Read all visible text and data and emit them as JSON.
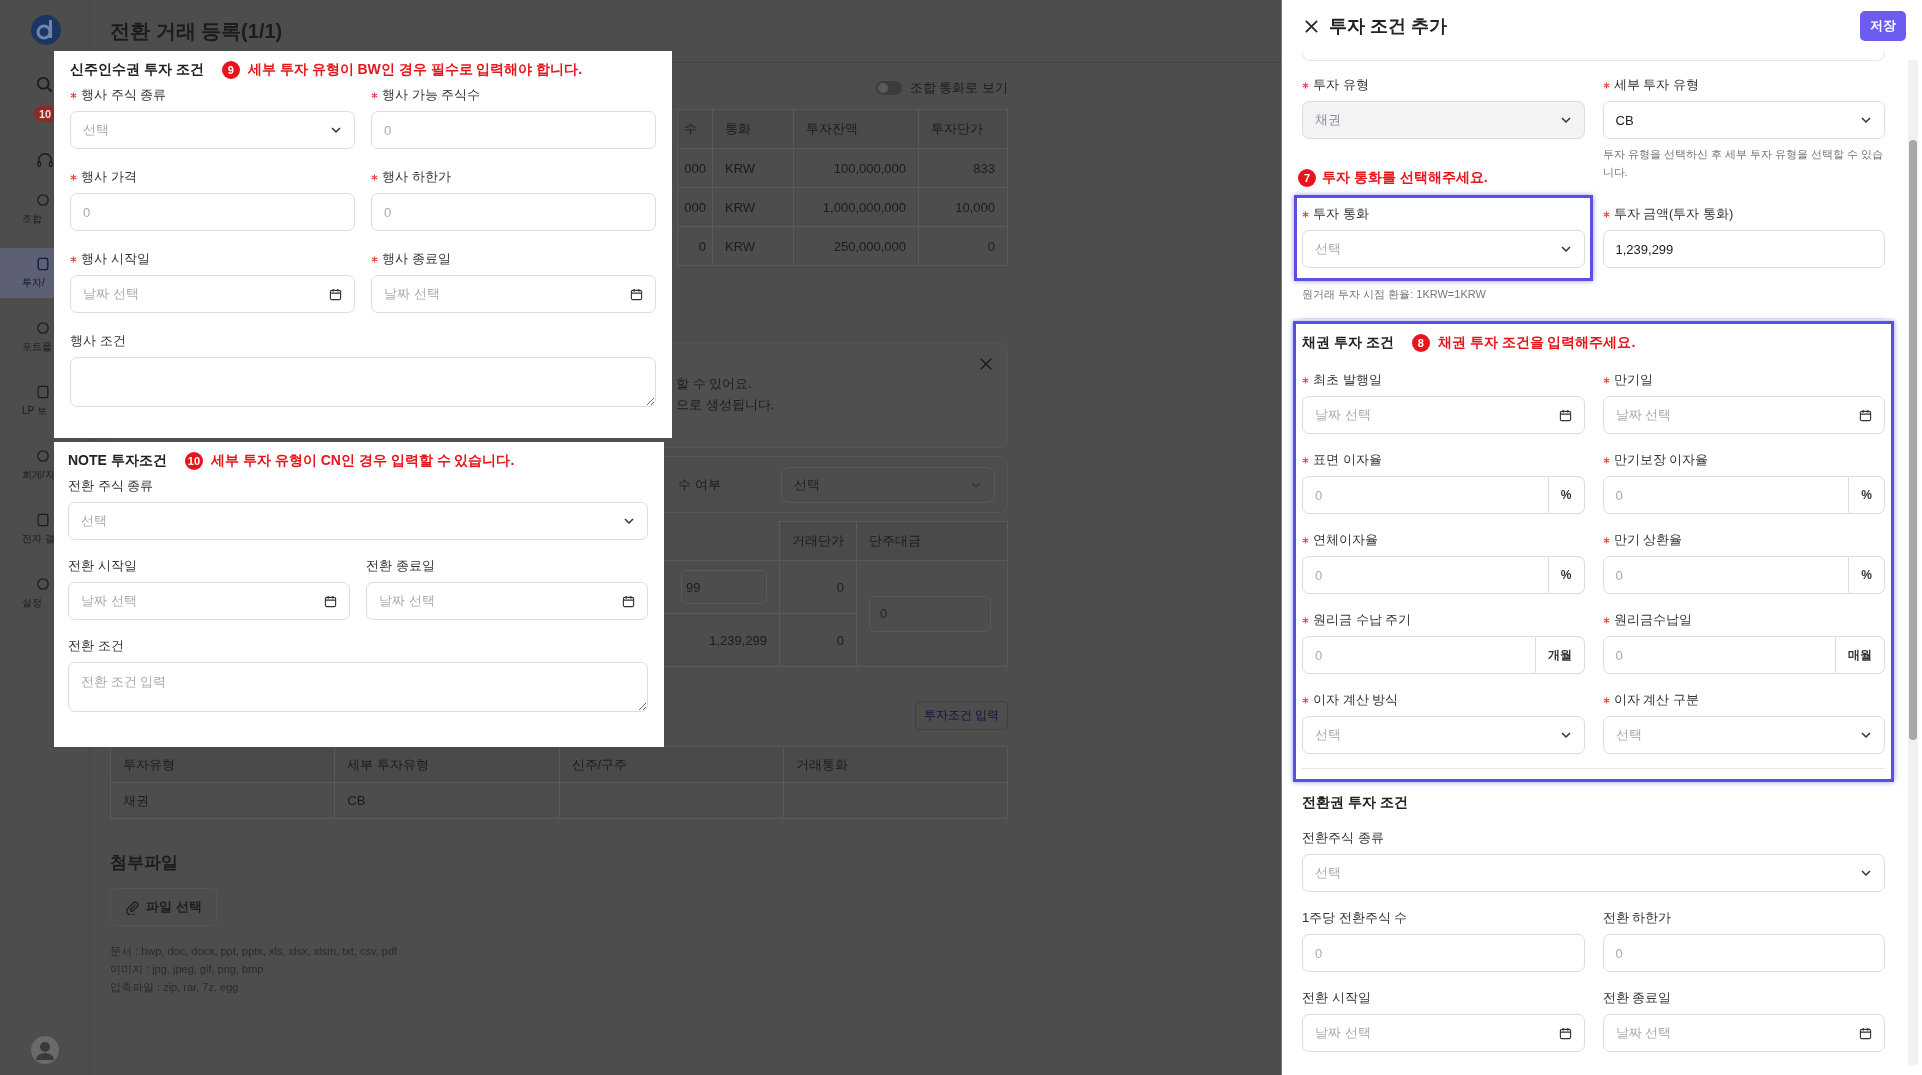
{
  "sidebar": {
    "badge": "10",
    "items": [
      {
        "label": "조합",
        "selected": false
      },
      {
        "label": "투자/",
        "selected": true
      },
      {
        "label": "포트폴",
        "selected": false
      },
      {
        "label": "LP 보",
        "selected": false
      },
      {
        "label": "회계/자",
        "selected": false
      },
      {
        "label": "전자 결",
        "selected": false
      },
      {
        "label": "설정",
        "selected": false
      }
    ]
  },
  "page": {
    "title": "전환 거래 등록(1/1)",
    "toggle": {
      "label": "조합 통화로 보기",
      "on": false
    },
    "summary_table": {
      "columns": [
        "수",
        "통화",
        "투자잔액",
        "투자단가"
      ],
      "rows": [
        [
          "000",
          "KRW",
          "100,000,000",
          "833"
        ],
        [
          "000",
          "KRW",
          "1,000,000,000",
          "10,000"
        ],
        [
          "0",
          "KRW",
          "250,000,000",
          "0"
        ]
      ]
    },
    "notice": {
      "lines": [
        "할 수 있어요.",
        "으로 생성됩니다."
      ]
    },
    "option_row": {
      "label": "수 여부",
      "select": {
        "placeholder": "선택"
      }
    },
    "trade_table": {
      "columns": [
        "거래단가",
        "단주대금"
      ],
      "rows": [
        {
          "amount": {
            "kind": "input",
            "text": "99"
          },
          "price": "0"
        },
        {
          "amount": {
            "kind": "text",
            "text": "1,239,299"
          },
          "price": "0"
        }
      ],
      "odd_lot": {
        "placeholder": "0"
      }
    },
    "terms_button": "투자조건 입력",
    "terms_table": {
      "columns": [
        "투자유형",
        "세부 투자유형",
        "신주/구주",
        "거래통화"
      ],
      "rows": [
        [
          "채권",
          "CB"
        ]
      ]
    },
    "attachments": {
      "title": "첨부파일",
      "button": "파일 선택",
      "notes": [
        "문서 : hwp, doc, docx, ppt, pptx, xls, xlsx, xlsm, txt, csv, pdf",
        "이미지 : jpg, jpeg, gif, png, bmp",
        "압축파일 : zip, rar, 7z, egg"
      ]
    }
  },
  "warrant_panel": {
    "title": "신주인수권 투자 조건",
    "annotation": {
      "number": "9",
      "text": "세부 투자 유형이 BW인 경우 필수로 입력해야 합니다."
    },
    "fields": [
      {
        "label": "행사 주식 종류",
        "required": true,
        "kind": "select",
        "placeholder": "선택"
      },
      {
        "label": "행사 가능 주식수",
        "required": true,
        "kind": "input",
        "placeholder": "0"
      },
      {
        "label": "행사 가격",
        "required": true,
        "kind": "input",
        "placeholder": "0"
      },
      {
        "label": "행사 하한가",
        "required": true,
        "kind": "input",
        "placeholder": "0"
      },
      {
        "label": "행사 시작일",
        "required": true,
        "kind": "date",
        "placeholder": "날짜 선택"
      },
      {
        "label": "행사 종료일",
        "required": true,
        "kind": "date",
        "placeholder": "날짜 선택"
      },
      {
        "label": "행사 조건",
        "required": false,
        "kind": "textarea",
        "wide": true
      }
    ]
  },
  "note_panel": {
    "title": "NOTE 투자조건",
    "annotation": {
      "number": "10",
      "text": "세부 투자 유형이 CN인 경우 입력할 수 있습니다."
    },
    "fields": [
      {
        "label": "전환 주식 종류",
        "required": false,
        "kind": "select",
        "placeholder": "선택",
        "wide": true
      },
      {
        "label": "전환 시작일",
        "required": false,
        "kind": "date",
        "placeholder": "날짜 선택"
      },
      {
        "label": "전환 종료일",
        "required": false,
        "kind": "date",
        "placeholder": "날짜 선택"
      },
      {
        "label": "전환 조건",
        "required": false,
        "kind": "textarea",
        "placeholder": "전환 조건 입력",
        "wide": true
      }
    ]
  },
  "drawer": {
    "title": "투자 조건 추가",
    "save_button": "저장",
    "type_field": {
      "label": "투자 유형",
      "required": true,
      "kind": "select",
      "value": "채권",
      "disabled": true
    },
    "subtype_field": {
      "label": "세부 투자 유형",
      "required": true,
      "kind": "select",
      "value": "CB",
      "disabled": false,
      "help": "투자 유형을 선택하신 후 세부 투자 유형을 선택할 수 있습니다."
    },
    "currency_annotation": {
      "number": "7",
      "text": "투자 통화를 선택해주세요."
    },
    "currency_field": {
      "label": "투자 통화",
      "required": true,
      "kind": "select",
      "placeholder": "선택",
      "disabled": false
    },
    "amount_field": {
      "label": "투자 금액(투자 통화)",
      "required": true,
      "kind": "input",
      "value": "1,239,299",
      "disabled": false
    },
    "rate_note": "원거래 투자 시점 환율: 1KRW=1KRW",
    "bond_section": {
      "title": "채권 투자 조건",
      "annotation": {
        "number": "8",
        "text": "채권 투자 조건을 입력해주세요."
      },
      "fields": [
        {
          "label": "최초 발행일",
          "required": true,
          "kind": "date",
          "placeholder": "날짜 선택"
        },
        {
          "label": "만기일",
          "required": true,
          "kind": "date",
          "placeholder": "날짜 선택"
        },
        {
          "label": "표면 이자율",
          "required": true,
          "kind": "suffix",
          "placeholder": "0",
          "suffix": "%"
        },
        {
          "label": "만기보장 이자율",
          "required": true,
          "kind": "suffix",
          "placeholder": "0",
          "suffix": "%"
        },
        {
          "label": "연체이자율",
          "required": true,
          "kind": "suffix",
          "placeholder": "0",
          "suffix": "%"
        },
        {
          "label": "만기 상환율",
          "required": true,
          "kind": "suffix",
          "placeholder": "0",
          "suffix": "%"
        },
        {
          "label": "원리금 수납 주기",
          "required": true,
          "kind": "suffix",
          "placeholder": "0",
          "suffix": "개월"
        },
        {
          "label": "원리금수납일",
          "required": true,
          "kind": "suffix",
          "placeholder": "0",
          "suffix": "매월"
        },
        {
          "label": "이자 계산 방식",
          "required": true,
          "kind": "select",
          "placeholder": "선택"
        },
        {
          "label": "이자 계산 구분",
          "required": true,
          "kind": "select",
          "placeholder": "선택"
        }
      ]
    },
    "conversion_section": {
      "title": "전환권 투자 조건",
      "fields": [
        {
          "label": "전환주식 종류",
          "required": false,
          "kind": "select",
          "placeholder": "선택",
          "wide": true
        },
        {
          "label": "1주당 전환주식 수",
          "required": false,
          "kind": "input",
          "placeholder": "0"
        },
        {
          "label": "전환 하한가",
          "required": false,
          "kind": "input",
          "placeholder": "0"
        },
        {
          "label": "전환 시작일",
          "required": false,
          "kind": "date",
          "placeholder": "날짜 선택"
        },
        {
          "label": "전환 종료일",
          "required": false,
          "kind": "date",
          "placeholder": "날짜 선택"
        }
      ]
    }
  }
}
